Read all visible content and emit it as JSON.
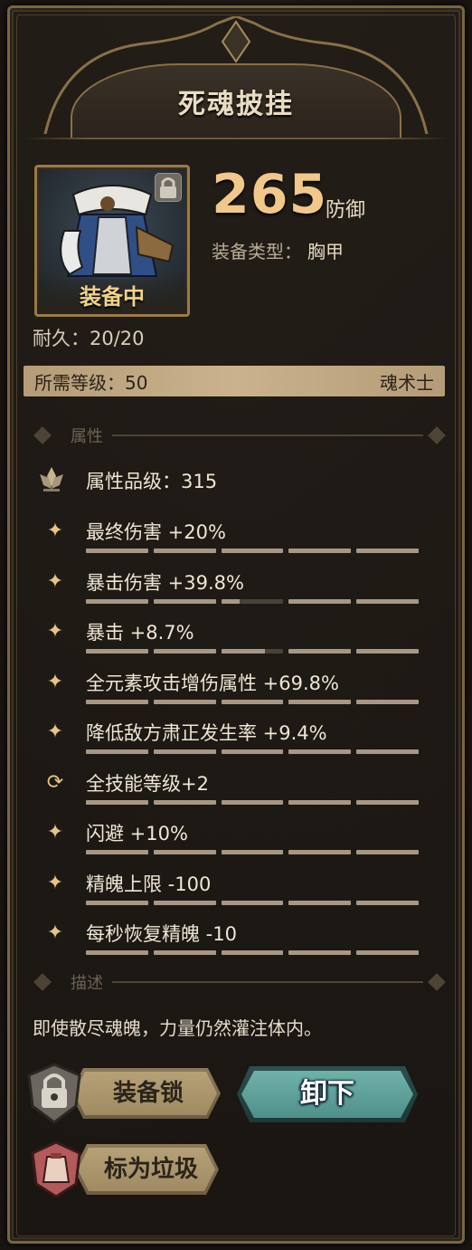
{
  "item": {
    "name": "死魂披挂",
    "equipped_label": "装备中",
    "durability_label": "耐久：",
    "durability_value": "20/20",
    "stat_value": "265",
    "stat_unit": "防御",
    "type_label": "装备类型：",
    "type_value": "胸甲",
    "level_label": "所需等级：",
    "level_value": "50",
    "class_value": "魂术士"
  },
  "sections": {
    "attributes": "属性",
    "description": "描述"
  },
  "quality": {
    "label": "属性品级：",
    "value": "315"
  },
  "attributes": [
    {
      "text": "最终伤害 +20%",
      "icon": "sparkle-icon",
      "fill": [
        1,
        1,
        1,
        1,
        1
      ]
    },
    {
      "text": "暴击伤害 +39.8%",
      "icon": "sparkle-icon",
      "fill": [
        1,
        1,
        0.3,
        1,
        1
      ]
    },
    {
      "text": "暴击 +8.7%",
      "icon": "sparkle-icon",
      "fill": [
        1,
        1,
        0.7,
        1,
        1
      ]
    },
    {
      "text": "全元素攻击增伤属性 +69.8%",
      "icon": "sparkle-icon",
      "fill": [
        1,
        1,
        1,
        1,
        1
      ]
    },
    {
      "text": "降低敌方肃正发生率 +9.4%",
      "icon": "sparkle-icon",
      "fill": [
        1,
        1,
        1,
        1,
        1
      ]
    },
    {
      "text": "全技能等级+2",
      "icon": "refresh-icon",
      "fill": [
        1,
        1,
        1,
        1,
        1
      ]
    },
    {
      "text": "闪避 +10%",
      "icon": "sparkle-icon",
      "fill": [
        1,
        1,
        1,
        1,
        1
      ]
    },
    {
      "text": "精魄上限 -100",
      "icon": "sparkle-icon",
      "fill": [
        1,
        1,
        1,
        1,
        1
      ]
    },
    {
      "text": "每秒恢复精魄 -10",
      "icon": "sparkle-icon",
      "fill": [
        1,
        1,
        1,
        1,
        1
      ]
    }
  ],
  "description": "即使散尽魂魄，力量仍然灌注体内。",
  "buttons": {
    "lock": "装备锁",
    "unequip": "卸下",
    "junk": "标为垃圾"
  },
  "colors": {
    "frame": "#7a6444",
    "accent_gold": "#f1c88a",
    "unequip_teal": "#5fa39b",
    "level_bar": "#c2aa84"
  }
}
